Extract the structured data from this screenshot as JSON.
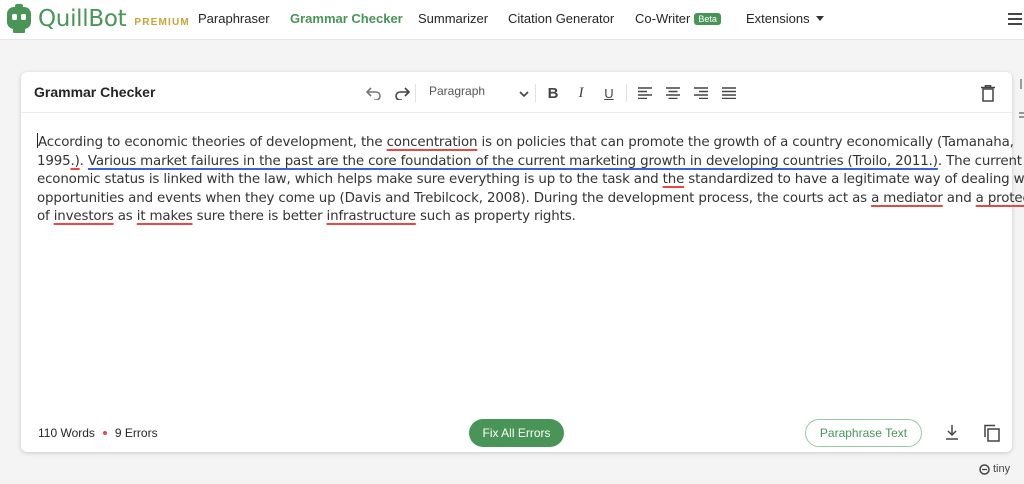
{
  "brand": {
    "name": "QuillBot",
    "badge": "PREMIUM",
    "color": "#499557"
  },
  "nav": {
    "items": [
      {
        "label": "Paraphraser",
        "active": false
      },
      {
        "label": "Grammar Checker",
        "active": true
      },
      {
        "label": "Summarizer",
        "active": false
      },
      {
        "label": "Citation Generator",
        "active": false
      },
      {
        "label": "Co-Writer",
        "active": false,
        "badge": "Beta"
      },
      {
        "label": "Extensions",
        "active": false,
        "dropdown": true
      }
    ],
    "menu_icon": "hamburger-icon"
  },
  "editor": {
    "title": "Grammar Checker",
    "toolbar": {
      "undo_icon": "undo-icon",
      "redo_icon": "redo-icon",
      "block_format": "Paragraph",
      "bold_label": "B",
      "italic_label": "I",
      "underline_label": "U",
      "align_icons": [
        "align-left-icon",
        "align-center-icon",
        "align-right-icon",
        "align-justify-icon"
      ],
      "delete_icon": "trash-icon"
    },
    "lines": [
      [
        {
          "t": "According to economic theories of development, the "
        },
        {
          "t": "concentration",
          "e": "red"
        },
        {
          "t": " is on policies that can promote the growth of a country economically (Tamanaha,"
        }
      ],
      [
        {
          "t": "1995"
        },
        {
          "t": ".)",
          "e": "red"
        },
        {
          "t": ". "
        },
        {
          "t": "Various market failures in the past are the core foundation of the current marketing growth in developing countries (Troilo, 2011.)",
          "e": "blue"
        },
        {
          "t": ". The current"
        }
      ],
      [
        {
          "t": "economic status is linked with the law, which helps make sure everything is up to the task and "
        },
        {
          "t": "the",
          "e": "red"
        },
        {
          "t": " standardized to have a legitimate way of dealing with"
        }
      ],
      [
        {
          "t": "opportunities and events when they come up (Davis and Trebilcock, 2008). During the development process, the courts act as "
        },
        {
          "t": "a mediator",
          "e": "red"
        },
        {
          "t": " and "
        },
        {
          "t": "a protector",
          "e": "red"
        }
      ],
      [
        {
          "t": "of "
        },
        {
          "t": "investors",
          "e": "red"
        },
        {
          "t": " as "
        },
        {
          "t": "it makes",
          "e": "red"
        },
        {
          "t": " sure there is better "
        },
        {
          "t": "infrastructure",
          "e": "red"
        },
        {
          "t": " such as property rights."
        }
      ]
    ],
    "footer": {
      "words": "110 Words",
      "errors": "9 Errors",
      "fix_button": "Fix All Errors",
      "paraphrase_button": "Paraphrase Text",
      "download_icon": "download-icon",
      "copy_icon": "copy-icon"
    }
  },
  "powered_by": "tiny",
  "colors": {
    "error_red": "#e74949",
    "clarity_blue": "#3a62d6",
    "accent_green": "#499557"
  }
}
